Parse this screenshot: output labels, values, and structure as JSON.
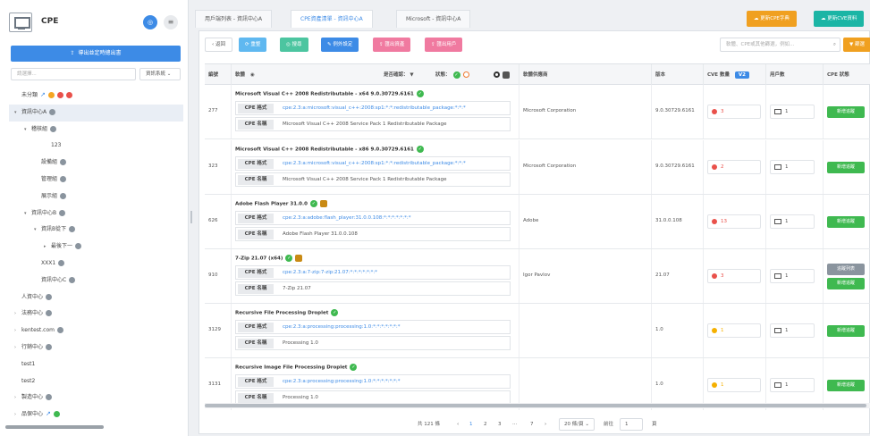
{
  "sidebar": {
    "title": "CPE",
    "avatar": "◎",
    "menu_icon": "≡",
    "primary_button": "導出並定時總出書",
    "filter_placeholder": "請選擇...",
    "filter_select": "資訊系統 ⌄",
    "tree": [
      {
        "label": "未分類",
        "indent": 0,
        "arrow": "",
        "icons": [
          "blue-arrow",
          "orange",
          "red",
          "red"
        ]
      },
      {
        "label": "資訊中心A",
        "indent": 0,
        "arrow": "▾",
        "icons": [
          "gray"
        ],
        "selected": true
      },
      {
        "label": "稽核組",
        "indent": 1,
        "arrow": "▾",
        "icons": [
          "gray"
        ]
      },
      {
        "label": "123",
        "indent": 3,
        "arrow": "",
        "icons": []
      },
      {
        "label": "設備組",
        "indent": 2,
        "arrow": "",
        "icons": [
          "gray"
        ]
      },
      {
        "label": "管理組",
        "indent": 2,
        "arrow": "",
        "icons": [
          "gray"
        ]
      },
      {
        "label": "展示組",
        "indent": 2,
        "arrow": "",
        "icons": [
          "gray"
        ]
      },
      {
        "label": "資訊中心B",
        "indent": 1,
        "arrow": "▾",
        "icons": [
          "gray"
        ]
      },
      {
        "label": "資訊B從下",
        "indent": 2,
        "arrow": "▾",
        "icons": [
          "gray"
        ]
      },
      {
        "label": "最後下一",
        "indent": 3,
        "arrow": "▸",
        "icons": [
          "gray"
        ]
      },
      {
        "label": "XXX1",
        "indent": 2,
        "arrow": "",
        "icons": [
          "gray"
        ]
      },
      {
        "label": "資訊中心C",
        "indent": 2,
        "arrow": "",
        "icons": [
          "gray"
        ]
      },
      {
        "label": "人資中心",
        "indent": 0,
        "arrow": "",
        "icons": [
          "gray"
        ]
      },
      {
        "label": "法務中心",
        "indent": 0,
        "arrow": "›",
        "icons": [
          "gray"
        ]
      },
      {
        "label": "kentest.com",
        "indent": 0,
        "arrow": "›",
        "icons": [
          "gray"
        ]
      },
      {
        "label": "行銷中心",
        "indent": 0,
        "arrow": "›",
        "icons": [
          "gray"
        ]
      },
      {
        "label": "test1",
        "indent": 0,
        "arrow": "",
        "icons": []
      },
      {
        "label": "test2",
        "indent": 0,
        "arrow": "",
        "icons": []
      },
      {
        "label": "製造中心",
        "indent": 0,
        "arrow": "›",
        "icons": [
          "gray"
        ]
      },
      {
        "label": "品保中心",
        "indent": 0,
        "arrow": "›",
        "icons": [
          "blue-arrow",
          "green"
        ]
      }
    ]
  },
  "tabs": [
    {
      "label": "用戶端列表 - 資訊中心A",
      "active": false
    },
    {
      "label": "CPE資產清單 - 資訊中心A",
      "active": true
    },
    {
      "label": "Microsoft - 資訊中心A",
      "active": false
    }
  ],
  "top_buttons": [
    {
      "label": "☁ 更新CPE字典",
      "color": "#f0a020"
    },
    {
      "label": "☁ 更新CVE資料",
      "color": "#1bb5a5"
    }
  ],
  "toolbar": {
    "back": "‹ 返回",
    "buttons": [
      {
        "label": "⟳ 重整",
        "color": "#5fb8f0"
      },
      {
        "label": "◎ 搜尋",
        "color": "#4cc5a0"
      },
      {
        "label": "✎ 例外設定",
        "color": "#3d8be6"
      },
      {
        "label": "⇪ 匯出資產",
        "color": "#f07aa0"
      },
      {
        "label": "⇪ 匯出用戶",
        "color": "#f07aa0"
      }
    ],
    "search_placeholder": "軟體、CPE或其他篩選，例如...",
    "search_icon": "⌕",
    "filter_button": "▼ 篩選"
  },
  "table": {
    "headers": {
      "id": "編號",
      "name": "軟體",
      "name_icon": "eye-icon",
      "name_filter": "是否確認： ▼",
      "status_filter": "狀態：",
      "vendor": "軟體供應商",
      "version": "版本",
      "cve": "CVE 數量",
      "cve_badge": "V2",
      "users": "用戶數",
      "cpe_status": "CPE 狀態"
    },
    "cpe_fmt_label": "CPE 格式",
    "cpe_name_label": "CPE 名稱",
    "rows": [
      {
        "id": "277",
        "name": "Microsoft Visual C++ 2008 Redistributable - x64 9.0.30729.6161",
        "icon2": "",
        "fmt": "cpe:2.3:a:microsoft:visual_c++:2008:sp1:*:*:redistributable_package:*:*:*",
        "cpe_name": "Microsoft Visual C++ 2008 Service Pack 1 Redistributable Package",
        "vendor": "Microsoft Corporation",
        "version": "9.0.30729.6161",
        "cve": "3",
        "cve_color": "#e9514b",
        "users": "1",
        "actions": [
          {
            "label": "新增追蹤",
            "color": "#3fb950"
          }
        ]
      },
      {
        "id": "323",
        "name": "Microsoft Visual C++ 2008 Redistributable - x86 9.0.30729.6161",
        "icon2": "",
        "fmt": "cpe:2.3:a:microsoft:visual_c++:2008:sp1:*:*:redistributable_package:*:*:*",
        "cpe_name": "Microsoft Visual C++ 2008 Service Pack 1 Redistributable Package",
        "vendor": "Microsoft Corporation",
        "version": "9.0.30729.6161",
        "cve": "2",
        "cve_color": "#e9514b",
        "users": "1",
        "actions": [
          {
            "label": "新增追蹤",
            "color": "#3fb950"
          }
        ]
      },
      {
        "id": "626",
        "name": "Adobe Flash Player 31.0.0",
        "icon2": "box",
        "fmt": "cpe:2.3:a:adobe:flash_player:31.0.0.108:*:*:*:*:*:*:*",
        "cpe_name": "Adobe Flash Player 31.0.0.108",
        "vendor": "Adobe",
        "version": "31.0.0.108",
        "cve": "13",
        "cve_color": "#e9514b",
        "users": "1",
        "actions": [
          {
            "label": "新增追蹤",
            "color": "#3fb950"
          }
        ]
      },
      {
        "id": "910",
        "name": "7-Zip 21.07 (x64)",
        "icon2": "box",
        "fmt": "cpe:2.3:a:7-zip:7-zip:21.07:*:*:*:*:*:*:*",
        "cpe_name": "7-Zip 21.07",
        "vendor": "Igor Pavlov",
        "version": "21.07",
        "cve": "3",
        "cve_color": "#e9514b",
        "users": "1",
        "actions": [
          {
            "label": "追蹤列表",
            "color": "#8a949e"
          },
          {
            "label": "新增追蹤",
            "color": "#3fb950"
          }
        ]
      },
      {
        "id": "3129",
        "name": "Recursive File Processing Droplet",
        "icon2": "",
        "fmt": "cpe:2.3:a:processing:processing:1.0:*:*:*:*:*:*:*",
        "cpe_name": "Processing 1.0",
        "vendor": "",
        "version": "1.0",
        "cve": "1",
        "cve_color": "#f5b000",
        "users": "1",
        "actions": [
          {
            "label": "新增追蹤",
            "color": "#3fb950"
          }
        ]
      },
      {
        "id": "3131",
        "name": "Recursive Image File Processing Droplet",
        "icon2": "",
        "fmt": "cpe:2.3:a:processing:processing:1.0:*:*:*:*:*:*:*",
        "cpe_name": "Processing 1.0",
        "vendor": "",
        "version": "1.0",
        "cve": "1",
        "cve_color": "#f5b000",
        "users": "1",
        "actions": [
          {
            "label": "新增追蹤",
            "color": "#3fb950"
          }
        ]
      }
    ]
  },
  "pager": {
    "total": "共 121 條",
    "prev": "‹",
    "pages": [
      "1",
      "2",
      "3",
      "···",
      "7"
    ],
    "next": "›",
    "page_size": "20 條/頁 ⌄",
    "goto_label": "前往",
    "goto_value": "1",
    "goto_suffix": "頁"
  }
}
